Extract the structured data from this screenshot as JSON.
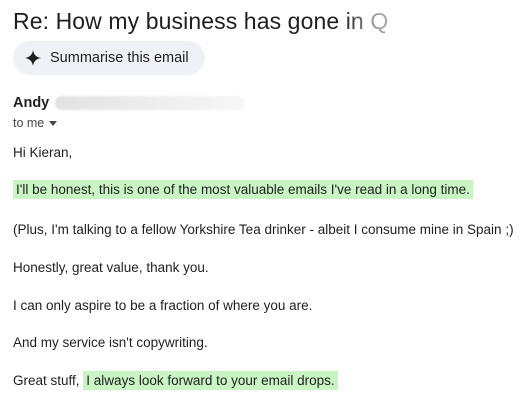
{
  "email": {
    "subject": "Re: How my business has gone in Q",
    "summarise_label": "Summarise this email",
    "sender_name": "Andy",
    "recipient": "to me",
    "body": {
      "greeting": "Hi Kieran,",
      "line1": "I'll be honest, this is one of the most valuable emails I've read in a long time.",
      "line2": "(Plus, I'm talking to a fellow Yorkshire Tea drinker - albeit I consume mine in Spain ;)",
      "line3": "Honestly, great value, thank you.",
      "line4": "I can only aspire to be a fraction of where you are.",
      "line5": "And my service isn't copywriting.",
      "line6_prefix": "Great stuff, ",
      "line6_highlight": "I always look forward to your email drops."
    }
  },
  "colors": {
    "highlight": "#c9f5c4",
    "button_bg": "#eef1f5",
    "text": "#1f1f1f"
  },
  "icons": {
    "summarise": "sparkle-icon",
    "recipient_menu": "caret-down-icon"
  }
}
